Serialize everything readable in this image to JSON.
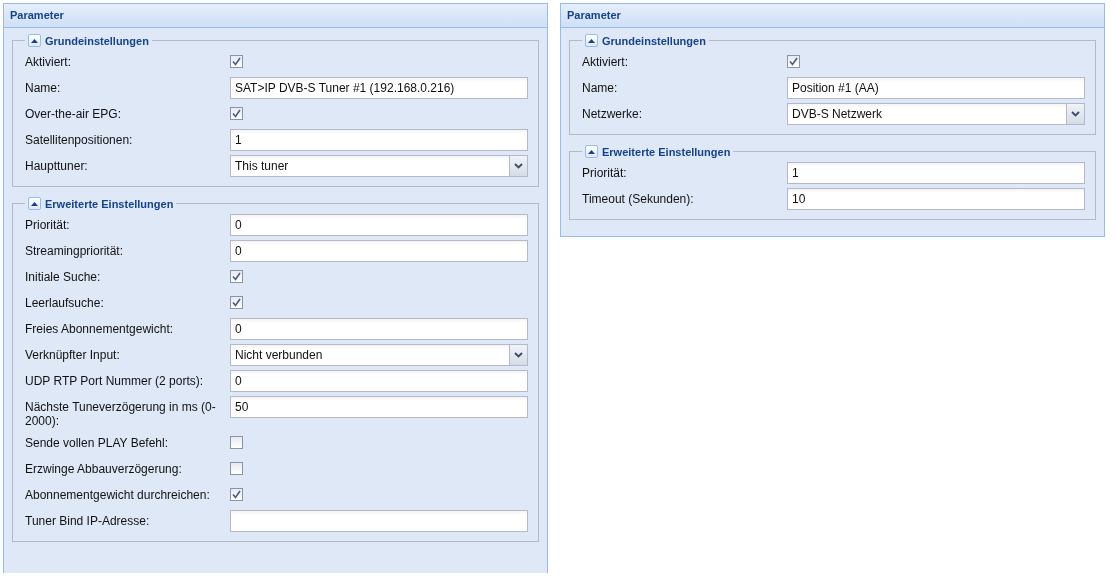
{
  "panels": [
    {
      "title": "Parameter",
      "sections": [
        {
          "title": "Grundeinstellungen",
          "expanded": true,
          "rows": [
            {
              "kind": "checkbox",
              "label": "Aktiviert:",
              "checked": true
            },
            {
              "kind": "text",
              "label": "Name:",
              "value": "SAT>IP DVB-S Tuner #1 (192.168.0.216)"
            },
            {
              "kind": "checkbox",
              "label": "Over-the-air EPG:",
              "checked": true
            },
            {
              "kind": "text",
              "label": "Satellitenpositionen:",
              "value": "1"
            },
            {
              "kind": "select",
              "label": "Haupttuner:",
              "value": "This tuner"
            }
          ]
        },
        {
          "title": "Erweiterte Einstellungen",
          "expanded": true,
          "rows": [
            {
              "kind": "text",
              "label": "Priorität:",
              "value": "0"
            },
            {
              "kind": "text",
              "label": "Streamingpriorität:",
              "value": "0"
            },
            {
              "kind": "checkbox",
              "label": "Initiale Suche:",
              "checked": true
            },
            {
              "kind": "checkbox",
              "label": "Leerlaufsuche:",
              "checked": true
            },
            {
              "kind": "text",
              "label": "Freies Abonnementgewicht:",
              "value": "0"
            },
            {
              "kind": "select",
              "label": "Verknüpfter Input:",
              "value": "Nicht verbunden"
            },
            {
              "kind": "text",
              "label": "UDP RTP Port Nummer (2 ports):",
              "value": "0"
            },
            {
              "kind": "text",
              "label": "Nächste Tuneverzögerung in ms (0-2000):",
              "value": "50"
            },
            {
              "kind": "checkbox",
              "label": "Sende vollen PLAY Befehl:",
              "checked": false
            },
            {
              "kind": "checkbox",
              "label": "Erzwinge Abbauverzögerung:",
              "checked": false
            },
            {
              "kind": "checkbox",
              "label": "Abonnementgewicht durchreichen:",
              "checked": true
            },
            {
              "kind": "text",
              "label": "Tuner Bind IP-Adresse:"
            }
          ]
        }
      ]
    },
    {
      "title": "Parameter",
      "sections": [
        {
          "title": "Grundeinstellungen",
          "expanded": true,
          "rows": [
            {
              "kind": "checkbox",
              "label": "Aktiviert:",
              "checked": true
            },
            {
              "kind": "text",
              "label": "Name:",
              "value": "Position #1 (AA)"
            },
            {
              "kind": "select",
              "label": "Netzwerke:",
              "value": "DVB-S Netzwerk"
            }
          ]
        },
        {
          "title": "Erweiterte Einstellungen",
          "expanded": true,
          "rows": [
            {
              "kind": "text",
              "label": "Priorität:",
              "value": "1"
            },
            {
              "kind": "text",
              "label": "Timeout (Sekunden):",
              "value": "10"
            }
          ]
        }
      ]
    }
  ]
}
